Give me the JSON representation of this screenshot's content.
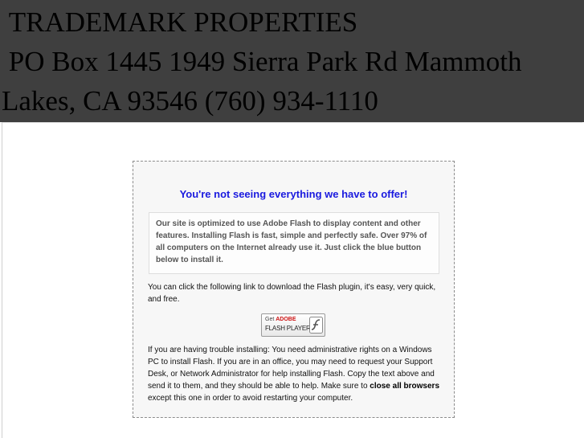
{
  "header": {
    "line1": " TRADEMARK PROPERTIES",
    "line2": " PO Box 1445 1949 Sierra Park Rd Mammoth Lakes, CA 93546 (760) 934-1110"
  },
  "notice": {
    "headline": "You're not seeing everything we have to offer!",
    "info": "Our site is optimized to use Adobe Flash to display content and other features. Installing Flash is fast, simple and perfectly safe. Over 97% of all computers on the Internet already use it. Just click the blue button below to install it.",
    "download": "You can click the following link to download the Flash plugin, it's easy, very quick, and free.",
    "badge": {
      "get": "Get",
      "brand": "ADOBE",
      "product": "FLASH PLAYER",
      "icon": "flash-player-icon"
    },
    "trouble_before": "If you are having trouble installing: You need administrative rights on a Windows PC to install Flash. If you are in an office, you may need to request your Support Desk, or Network Administrator for help installing Flash. Copy the text above and send it to them, and they should be able to help. Make sure to ",
    "trouble_bold": "close all browsers",
    "trouble_after": " except this one in order to avoid restarting your computer."
  },
  "colors": {
    "header_bg": "#3f3f3f",
    "headline": "#1a1adf",
    "box_bg": "#f7f7f7"
  }
}
